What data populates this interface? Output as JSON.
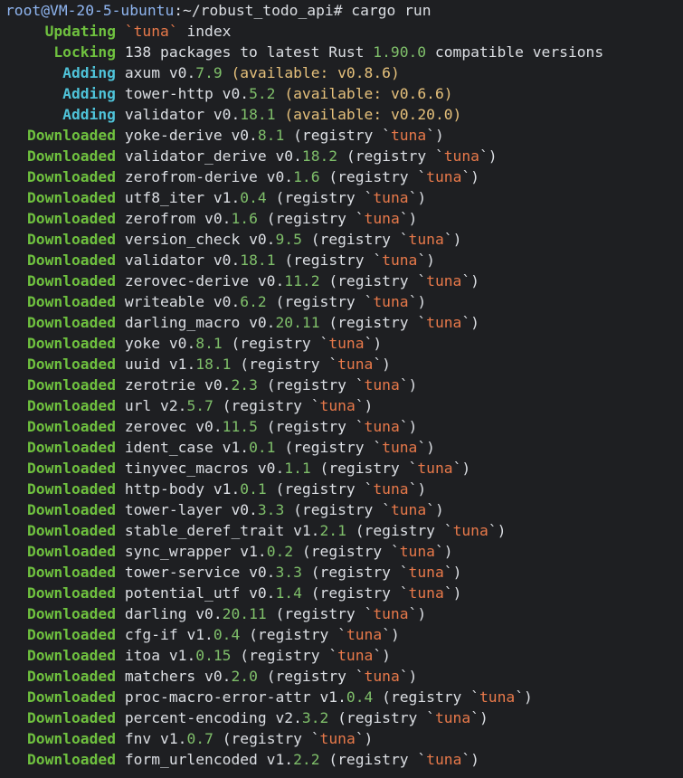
{
  "colors": {
    "background": "#1e1f22",
    "prompt": "#8fb5f0",
    "status_green": "#6fc13f",
    "status_cyan": "#4fc3d9",
    "version": "#7fbf6a",
    "available": "#e5c07b",
    "registry_name": "#e8794a"
  },
  "prompt": {
    "user_host": "root@VM-20-5-ubuntu",
    "path_suffix": ":~/robust_todo_api# ",
    "command": "cargo run"
  },
  "header_lines": [
    {
      "status": "Updating",
      "pre": "",
      "highlight": "`tuna`",
      "post": " index"
    },
    {
      "status": "Locking",
      "pre": "138 packages to latest Rust ",
      "highlight": "1.90.0",
      "post": " compatible versions"
    }
  ],
  "adding": [
    {
      "status": "Adding",
      "name": "axum",
      "ver_v": "v0.",
      "ver_num": "7.9",
      "available": "(available: v0.8.6)"
    },
    {
      "status": "Adding",
      "name": "tower-http",
      "ver_v": "v0.",
      "ver_num": "5.2",
      "available": "(available: v0.6.6)"
    },
    {
      "status": "Adding",
      "name": "validator",
      "ver_v": "v0.",
      "ver_num": "18.1",
      "available": "(available: v0.20.0)"
    }
  ],
  "downloaded": [
    {
      "status": "Downloaded",
      "name": "yoke-derive",
      "ver_v": "v0.",
      "ver_num": "8.1",
      "reg_open": "(registry `",
      "reg_name": "tuna",
      "reg_close": "`)"
    },
    {
      "status": "Downloaded",
      "name": "validator_derive",
      "ver_v": "v0.",
      "ver_num": "18.2",
      "reg_open": "(registry `",
      "reg_name": "tuna",
      "reg_close": "`)"
    },
    {
      "status": "Downloaded",
      "name": "zerofrom-derive",
      "ver_v": "v0.",
      "ver_num": "1.6",
      "reg_open": "(registry `",
      "reg_name": "tuna",
      "reg_close": "`)"
    },
    {
      "status": "Downloaded",
      "name": "utf8_iter",
      "ver_v": "v1.",
      "ver_num": "0.4",
      "reg_open": "(registry `",
      "reg_name": "tuna",
      "reg_close": "`)"
    },
    {
      "status": "Downloaded",
      "name": "zerofrom",
      "ver_v": "v0.",
      "ver_num": "1.6",
      "reg_open": "(registry `",
      "reg_name": "tuna",
      "reg_close": "`)"
    },
    {
      "status": "Downloaded",
      "name": "version_check",
      "ver_v": "v0.",
      "ver_num": "9.5",
      "reg_open": "(registry `",
      "reg_name": "tuna",
      "reg_close": "`)"
    },
    {
      "status": "Downloaded",
      "name": "validator",
      "ver_v": "v0.",
      "ver_num": "18.1",
      "reg_open": "(registry `",
      "reg_name": "tuna",
      "reg_close": "`)"
    },
    {
      "status": "Downloaded",
      "name": "zerovec-derive",
      "ver_v": "v0.",
      "ver_num": "11.2",
      "reg_open": "(registry `",
      "reg_name": "tuna",
      "reg_close": "`)"
    },
    {
      "status": "Downloaded",
      "name": "writeable",
      "ver_v": "v0.",
      "ver_num": "6.2",
      "reg_open": "(registry `",
      "reg_name": "tuna",
      "reg_close": "`)"
    },
    {
      "status": "Downloaded",
      "name": "darling_macro",
      "ver_v": "v0.",
      "ver_num": "20.11",
      "reg_open": "(registry `",
      "reg_name": "tuna",
      "reg_close": "`)"
    },
    {
      "status": "Downloaded",
      "name": "yoke",
      "ver_v": "v0.",
      "ver_num": "8.1",
      "reg_open": "(registry `",
      "reg_name": "tuna",
      "reg_close": "`)"
    },
    {
      "status": "Downloaded",
      "name": "uuid",
      "ver_v": "v1.",
      "ver_num": "18.1",
      "reg_open": "(registry `",
      "reg_name": "tuna",
      "reg_close": "`)"
    },
    {
      "status": "Downloaded",
      "name": "zerotrie",
      "ver_v": "v0.",
      "ver_num": "2.3",
      "reg_open": "(registry `",
      "reg_name": "tuna",
      "reg_close": "`)"
    },
    {
      "status": "Downloaded",
      "name": "url",
      "ver_v": "v2.",
      "ver_num": "5.7",
      "reg_open": "(registry `",
      "reg_name": "tuna",
      "reg_close": "`)"
    },
    {
      "status": "Downloaded",
      "name": "zerovec",
      "ver_v": "v0.",
      "ver_num": "11.5",
      "reg_open": "(registry `",
      "reg_name": "tuna",
      "reg_close": "`)"
    },
    {
      "status": "Downloaded",
      "name": "ident_case",
      "ver_v": "v1.",
      "ver_num": "0.1",
      "reg_open": "(registry `",
      "reg_name": "tuna",
      "reg_close": "`)"
    },
    {
      "status": "Downloaded",
      "name": "tinyvec_macros",
      "ver_v": "v0.",
      "ver_num": "1.1",
      "reg_open": "(registry `",
      "reg_name": "tuna",
      "reg_close": "`)"
    },
    {
      "status": "Downloaded",
      "name": "http-body",
      "ver_v": "v1.",
      "ver_num": "0.1",
      "reg_open": "(registry `",
      "reg_name": "tuna",
      "reg_close": "`)"
    },
    {
      "status": "Downloaded",
      "name": "tower-layer",
      "ver_v": "v0.",
      "ver_num": "3.3",
      "reg_open": "(registry `",
      "reg_name": "tuna",
      "reg_close": "`)"
    },
    {
      "status": "Downloaded",
      "name": "stable_deref_trait",
      "ver_v": "v1.",
      "ver_num": "2.1",
      "reg_open": "(registry `",
      "reg_name": "tuna",
      "reg_close": "`)"
    },
    {
      "status": "Downloaded",
      "name": "sync_wrapper",
      "ver_v": "v1.",
      "ver_num": "0.2",
      "reg_open": "(registry `",
      "reg_name": "tuna",
      "reg_close": "`)"
    },
    {
      "status": "Downloaded",
      "name": "tower-service",
      "ver_v": "v0.",
      "ver_num": "3.3",
      "reg_open": "(registry `",
      "reg_name": "tuna",
      "reg_close": "`)"
    },
    {
      "status": "Downloaded",
      "name": "potential_utf",
      "ver_v": "v0.",
      "ver_num": "1.4",
      "reg_open": "(registry `",
      "reg_name": "tuna",
      "reg_close": "`)"
    },
    {
      "status": "Downloaded",
      "name": "darling",
      "ver_v": "v0.",
      "ver_num": "20.11",
      "reg_open": "(registry `",
      "reg_name": "tuna",
      "reg_close": "`)"
    },
    {
      "status": "Downloaded",
      "name": "cfg-if",
      "ver_v": "v1.",
      "ver_num": "0.4",
      "reg_open": "(registry `",
      "reg_name": "tuna",
      "reg_close": "`)"
    },
    {
      "status": "Downloaded",
      "name": "itoa",
      "ver_v": "v1.",
      "ver_num": "0.15",
      "reg_open": "(registry `",
      "reg_name": "tuna",
      "reg_close": "`)"
    },
    {
      "status": "Downloaded",
      "name": "matchers",
      "ver_v": "v0.",
      "ver_num": "2.0",
      "reg_open": "(registry `",
      "reg_name": "tuna",
      "reg_close": "`)"
    },
    {
      "status": "Downloaded",
      "name": "proc-macro-error-attr",
      "ver_v": "v1.",
      "ver_num": "0.4",
      "reg_open": "(registry `",
      "reg_name": "tuna",
      "reg_close": "`)"
    },
    {
      "status": "Downloaded",
      "name": "percent-encoding",
      "ver_v": "v2.",
      "ver_num": "3.2",
      "reg_open": "(registry `",
      "reg_name": "tuna",
      "reg_close": "`)"
    },
    {
      "status": "Downloaded",
      "name": "fnv",
      "ver_v": "v1.",
      "ver_num": "0.7",
      "reg_open": "(registry `",
      "reg_name": "tuna",
      "reg_close": "`)"
    },
    {
      "status": "Downloaded",
      "name": "form_urlencoded",
      "ver_v": "v1.",
      "ver_num": "2.2",
      "reg_open": "(registry `",
      "reg_name": "tuna",
      "reg_close": "`)"
    }
  ]
}
